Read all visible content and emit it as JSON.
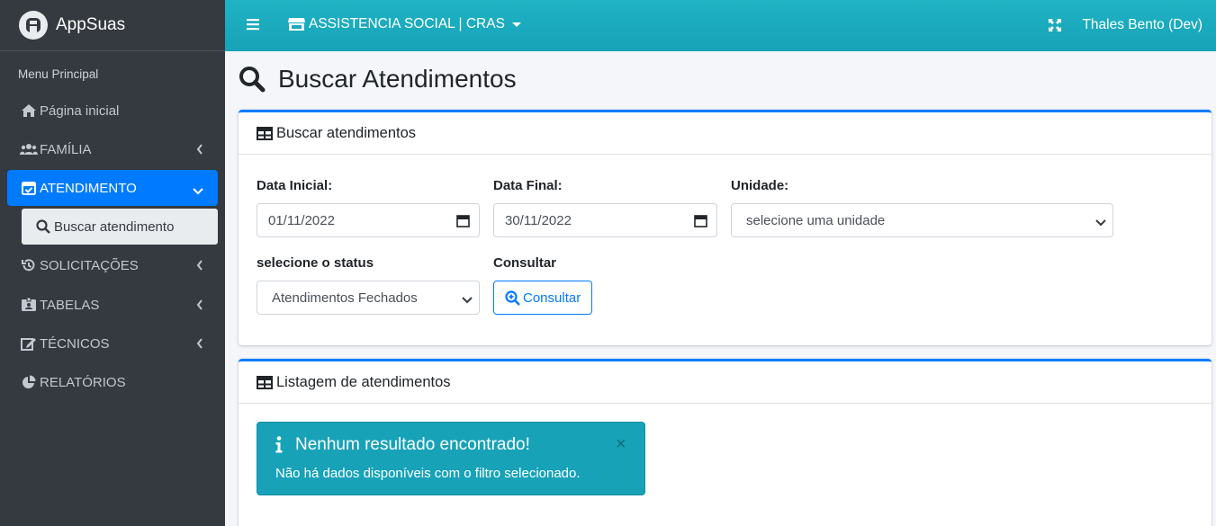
{
  "app": {
    "name": "AppSuas"
  },
  "sidebar": {
    "menu_header": "Menu Principal",
    "items": [
      {
        "label": "Página inicial",
        "icon": "home-icon"
      },
      {
        "label": "FAMÍLIA",
        "icon": "users-icon"
      },
      {
        "label": "ATENDIMENTO",
        "icon": "calendar-check-icon",
        "active": true
      },
      {
        "label": "SOLICITAÇÕES",
        "icon": "history-icon"
      },
      {
        "label": "TABELAS",
        "icon": "id-badge-icon"
      },
      {
        "label": "TÉCNICOS",
        "icon": "edit-icon"
      },
      {
        "label": "RELATÓRIOS",
        "icon": "pie-chart-icon"
      }
    ],
    "subitem": {
      "label": "Buscar atendimento",
      "icon": "search-icon"
    }
  },
  "topbar": {
    "unit_label": "ASSISTENCIA SOCIAL | CRAS",
    "user": "Thales Bento (Dev)"
  },
  "page": {
    "title": "Buscar Atendimentos"
  },
  "search_card": {
    "title": "Buscar atendimentos",
    "data_inicial_label": "Data Inicial:",
    "data_inicial_value": "01/11/2022",
    "data_final_label": "Data Final:",
    "data_final_value": "30/11/2022",
    "unidade_label": "Unidade:",
    "unidade_value": "selecione uma unidade",
    "status_label": "selecione o status",
    "status_value": "Atendimentos Fechados",
    "consultar_label": "Consultar",
    "consultar_button": "Consultar"
  },
  "list_card": {
    "title": "Listagem de atendimentos",
    "alert_title": "Nenhum resultado encontrado!",
    "alert_text": "Não há dados disponíveis com o filtro selecionado.",
    "alert_close": "×"
  },
  "colors": {
    "primary": "#007bff",
    "info": "#17a2b8",
    "sidebar": "#343a40"
  }
}
